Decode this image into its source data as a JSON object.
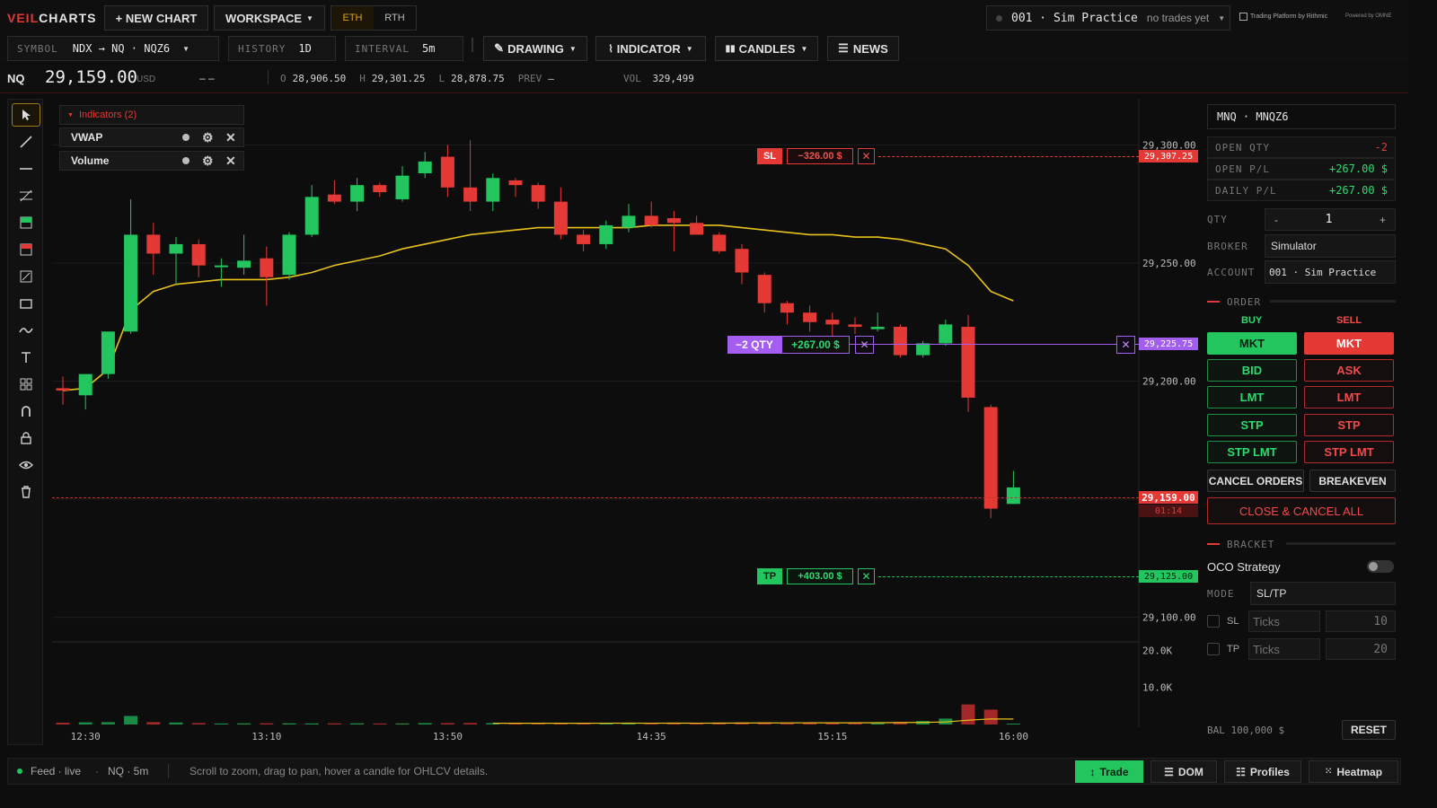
{
  "brand": {
    "part1": "VEIL",
    "part2": "CHARTS",
    "accent": "#e53935"
  },
  "top": {
    "new_chart": "+ NEW CHART",
    "workspace": "WORKSPACE",
    "session_eth": "ETH",
    "session_rth": "RTH",
    "account_id": "001 · Sim Practice",
    "account_note": "no trades yet",
    "rithmic": "Trading Platform by Rithmic",
    "omne": "Powered by OMNE"
  },
  "toolbar": {
    "symbol_label": "SYMBOL",
    "symbol_value": "NDX → NQ · NQZ6",
    "history_label": "HISTORY",
    "history_value": "1D",
    "interval_label": "INTERVAL",
    "interval_value": "5m",
    "drawing": "DRAWING",
    "indicator": "INDICATOR",
    "candles": "CANDLES",
    "news": "NEWS"
  },
  "quote": {
    "sym": "NQ",
    "price": "29,159.00",
    "ccy": "USD",
    "change": "– –",
    "o_label": "O",
    "o": "28,906.50",
    "h_label": "H",
    "h": "29,301.25",
    "l_label": "L",
    "l": "28,878.75",
    "prev_label": "PREV",
    "prev": "—",
    "vol_label": "VOL",
    "vol": "329,499"
  },
  "indicators": {
    "header": "Indicators (2)",
    "items": [
      {
        "name": "VWAP"
      },
      {
        "name": "Volume"
      }
    ]
  },
  "orders": {
    "sl": {
      "tag": "SL",
      "pnl": "−326.00 $",
      "price": "29,307.25"
    },
    "pos": {
      "qty": "−2 QTY",
      "pnl": "+267.00 $",
      "price": "29,225.75"
    },
    "tp": {
      "tag": "TP",
      "pnl": "+403.00 $",
      "price": "29,125.00"
    }
  },
  "last": {
    "price": "29,159.00",
    "timer": "01:14"
  },
  "y_axis": [
    "29,300.00",
    "29,250.00",
    "29,200.00",
    "29,100.00"
  ],
  "vol_axis": [
    "20.0K",
    "10.0K"
  ],
  "x_axis": [
    "12:30",
    "13:10",
    "13:50",
    "14:35",
    "15:15",
    "16:00"
  ],
  "colors": {
    "up": "#22c55e",
    "down": "#e53935",
    "vwap": "#e8c21a",
    "pos": "#a35df0"
  },
  "chart_data": {
    "type": "candlestick",
    "instrument": "NQ · NQZ6",
    "ylim": [
      29093,
      29315
    ],
    "candles": [
      {
        "o": 29197,
        "h": 29202,
        "l": 29190,
        "c": 29196
      },
      {
        "o": 29194,
        "h": 29202,
        "l": 29188,
        "c": 29203
      },
      {
        "o": 29203,
        "h": 29218,
        "l": 29201,
        "c": 29221
      },
      {
        "o": 29221,
        "h": 29277,
        "l": 29220,
        "c": 29262
      },
      {
        "o": 29262,
        "h": 29267,
        "l": 29245,
        "c": 29254
      },
      {
        "o": 29254,
        "h": 29261,
        "l": 29241,
        "c": 29258
      },
      {
        "o": 29258,
        "h": 29260,
        "l": 29244,
        "c": 29249
      },
      {
        "o": 29249,
        "h": 29252,
        "l": 29240,
        "c": 29249
      },
      {
        "o": 29248,
        "h": 29262,
        "l": 29245,
        "c": 29251
      },
      {
        "o": 29252,
        "h": 29257,
        "l": 29232,
        "c": 29244
      },
      {
        "o": 29245,
        "h": 29263,
        "l": 29243,
        "c": 29262
      },
      {
        "o": 29262,
        "h": 29283,
        "l": 29261,
        "c": 29278
      },
      {
        "o": 29279,
        "h": 29285,
        "l": 29275,
        "c": 29276
      },
      {
        "o": 29276,
        "h": 29286,
        "l": 29272,
        "c": 29283
      },
      {
        "o": 29283,
        "h": 29284,
        "l": 29278,
        "c": 29280
      },
      {
        "o": 29277,
        "h": 29291,
        "l": 29276,
        "c": 29287
      },
      {
        "o": 29288,
        "h": 29297,
        "l": 29286,
        "c": 29293
      },
      {
        "o": 29295,
        "h": 29300,
        "l": 29278,
        "c": 29282
      },
      {
        "o": 29282,
        "h": 29302,
        "l": 29272,
        "c": 29276
      },
      {
        "o": 29276,
        "h": 29288,
        "l": 29272,
        "c": 29286
      },
      {
        "o": 29285,
        "h": 29286,
        "l": 29278,
        "c": 29283
      },
      {
        "o": 29283,
        "h": 29284,
        "l": 29273,
        "c": 29276
      },
      {
        "o": 29276,
        "h": 29282,
        "l": 29260,
        "c": 29262
      },
      {
        "o": 29262,
        "h": 29264,
        "l": 29255,
        "c": 29258
      },
      {
        "o": 29258,
        "h": 29268,
        "l": 29256,
        "c": 29266
      },
      {
        "o": 29265,
        "h": 29275,
        "l": 29263,
        "c": 29270
      },
      {
        "o": 29270,
        "h": 29276,
        "l": 29265,
        "c": 29266
      },
      {
        "o": 29269,
        "h": 29272,
        "l": 29255,
        "c": 29267
      },
      {
        "o": 29267,
        "h": 29270,
        "l": 29262,
        "c": 29262
      },
      {
        "o": 29262,
        "h": 29263,
        "l": 29254,
        "c": 29255
      },
      {
        "o": 29256,
        "h": 29258,
        "l": 29241,
        "c": 29246
      },
      {
        "o": 29245,
        "h": 29246,
        "l": 29229,
        "c": 29233
      },
      {
        "o": 29233,
        "h": 29234,
        "l": 29224,
        "c": 29229
      },
      {
        "o": 29229,
        "h": 29232,
        "l": 29221,
        "c": 29225
      },
      {
        "o": 29226,
        "h": 29229,
        "l": 29216,
        "c": 29224
      },
      {
        "o": 29224,
        "h": 29227,
        "l": 29220,
        "c": 29223
      },
      {
        "o": 29222,
        "h": 29229,
        "l": 29221,
        "c": 29223
      },
      {
        "o": 29223,
        "h": 29224,
        "l": 29210,
        "c": 29211
      },
      {
        "o": 29211,
        "h": 29217,
        "l": 29210,
        "c": 29216
      },
      {
        "o": 29216,
        "h": 29226,
        "l": 29215,
        "c": 29224
      },
      {
        "o": 29223,
        "h": 29228,
        "l": 29187,
        "c": 29193
      },
      {
        "o": 29189,
        "h": 29190,
        "l": 29142,
        "c": 29146
      },
      {
        "o": 29148,
        "h": 29162,
        "l": 29148,
        "c": 29155
      }
    ],
    "volume": [
      480,
      580,
      640,
      2300,
      640,
      540,
      390,
      280,
      320,
      330,
      330,
      300,
      310,
      320,
      270,
      300,
      390,
      380,
      410,
      380,
      320,
      290,
      250,
      320,
      420,
      380,
      370,
      420,
      370,
      520,
      560,
      580,
      450,
      420,
      380,
      520,
      560,
      730,
      950,
      1600,
      5400,
      4000,
      250
    ],
    "vwap": [
      29196,
      29197,
      29205,
      29230,
      29238,
      29241,
      29242,
      29243,
      29243,
      29243,
      29244,
      29246,
      29249,
      29251,
      29253,
      29256,
      29258,
      29260,
      29262,
      29263,
      29264,
      29265,
      29265,
      29265,
      29265,
      29265,
      29266,
      29266,
      29266,
      29266,
      29265,
      29264,
      29263,
      29262,
      29262,
      29261,
      29261,
      29260,
      29258,
      29256,
      29249,
      29238,
      29234
    ],
    "vol_ylim": [
      0,
      22000
    ]
  },
  "panel": {
    "symbol": "MNQ · MNQZ6",
    "open_qty_label": "OPEN QTY",
    "open_qty": "-2",
    "open_pl_label": "OPEN P/L",
    "open_pl": "+267.00 $",
    "daily_pl_label": "DAILY P/L",
    "daily_pl": "+267.00 $",
    "qty_label": "QTY",
    "qty": "1",
    "minus": "-",
    "plus": "+",
    "broker_label": "BROKER",
    "broker": "Simulator",
    "account_label": "ACCOUNT",
    "account": "001 · Sim Practice",
    "order_label": "ORDER",
    "buy_label": "BUY",
    "sell_label": "SELL",
    "buy": [
      "MKT",
      "BID",
      "LMT",
      "STP",
      "STP LMT"
    ],
    "sell": [
      "MKT",
      "ASK",
      "LMT",
      "STP",
      "STP LMT"
    ],
    "cancel_orders": "CANCEL ORDERS",
    "breakeven": "BREAKEVEN",
    "close_cancel": "CLOSE & CANCEL ALL",
    "bracket_label": "BRACKET",
    "oco": "OCO Strategy",
    "mode_label": "MODE",
    "mode": "SL/TP",
    "sl_label": "SL",
    "tp_label": "TP",
    "ticks_placeholder": "Ticks",
    "sl_ticks": "10",
    "tp_ticks": "20",
    "bal": "BAL 100,000 $",
    "reset": "RESET"
  },
  "status": {
    "feed": "Feed · live",
    "sym": "NQ · 5m",
    "hint": "Scroll to zoom, drag to pan, hover a candle for OHLCV details.",
    "trade": "Trade",
    "dom": "DOM",
    "profiles": "Profiles",
    "heatmap": "Heatmap"
  }
}
